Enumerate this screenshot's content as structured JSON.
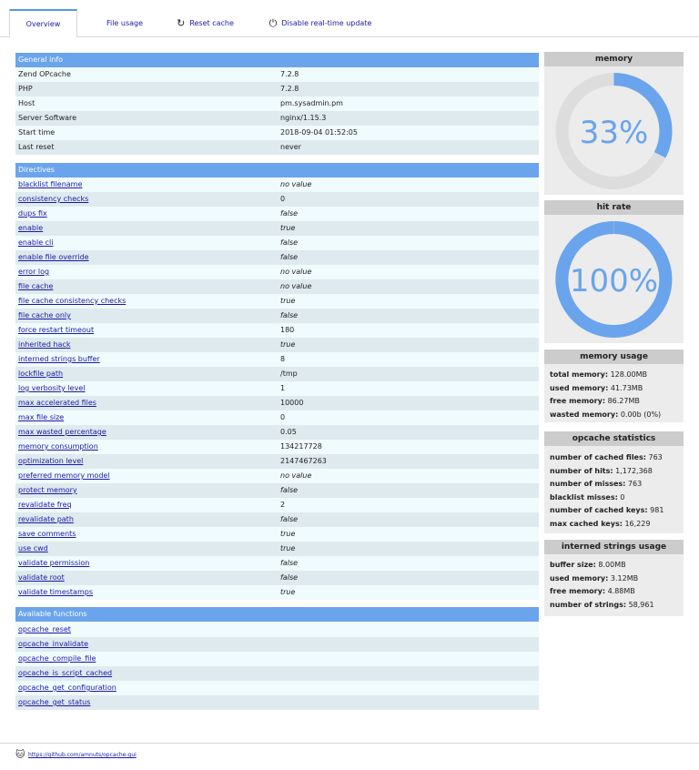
{
  "tabs": {
    "overview": "Overview",
    "file_usage": "File usage",
    "reset_cache": "Reset cache",
    "disable_realtime": "Disable real-time update"
  },
  "general_info": {
    "header": "General info",
    "rows": [
      {
        "k": "Zend OPcache",
        "v": "7.2.8"
      },
      {
        "k": "PHP",
        "v": "7.2.8"
      },
      {
        "k": "Host",
        "v": "pm.sysadmin.pm"
      },
      {
        "k": "Server Software",
        "v": "nginx/1.15.3"
      },
      {
        "k": "Start time",
        "v": "2018-09-04 01:52:05"
      },
      {
        "k": "Last reset",
        "v": "never"
      }
    ]
  },
  "directives": {
    "header": "Directives",
    "rows": [
      {
        "k": "blacklist filename",
        "v": "no value",
        "italic": true
      },
      {
        "k": "consistency checks",
        "v": "0",
        "italic": false
      },
      {
        "k": "dups fix",
        "v": "false",
        "italic": true
      },
      {
        "k": "enable",
        "v": "true",
        "italic": true
      },
      {
        "k": "enable cli",
        "v": "false",
        "italic": true
      },
      {
        "k": "enable file override",
        "v": "false",
        "italic": true
      },
      {
        "k": "error log",
        "v": "no value",
        "italic": true
      },
      {
        "k": "file cache",
        "v": "no value",
        "italic": true
      },
      {
        "k": "file cache consistency checks",
        "v": "true",
        "italic": true
      },
      {
        "k": "file cache only",
        "v": "false",
        "italic": true
      },
      {
        "k": "force restart timeout",
        "v": "180",
        "italic": false
      },
      {
        "k": "inherited hack",
        "v": "true",
        "italic": true
      },
      {
        "k": "interned strings buffer",
        "v": "8",
        "italic": false
      },
      {
        "k": "lockfile path",
        "v": "/tmp",
        "italic": false
      },
      {
        "k": "log verbosity level",
        "v": "1",
        "italic": false
      },
      {
        "k": "max accelerated files",
        "v": "10000",
        "italic": false
      },
      {
        "k": "max file size",
        "v": "0",
        "italic": false
      },
      {
        "k": "max wasted percentage",
        "v": "0.05",
        "italic": false
      },
      {
        "k": "memory consumption",
        "v": "134217728",
        "italic": false
      },
      {
        "k": "optimization level",
        "v": "2147467263",
        "italic": false
      },
      {
        "k": "preferred memory model",
        "v": "no value",
        "italic": true
      },
      {
        "k": "protect memory",
        "v": "false",
        "italic": true
      },
      {
        "k": "revalidate freq",
        "v": "2",
        "italic": false
      },
      {
        "k": "revalidate path",
        "v": "false",
        "italic": true
      },
      {
        "k": "save comments",
        "v": "true",
        "italic": true
      },
      {
        "k": "use cwd",
        "v": "true",
        "italic": true
      },
      {
        "k": "validate permission",
        "v": "false",
        "italic": true
      },
      {
        "k": "validate root",
        "v": "false",
        "italic": true
      },
      {
        "k": "validate timestamps",
        "v": "true",
        "italic": true
      }
    ]
  },
  "functions": {
    "header": "Available functions",
    "rows": [
      "opcache_reset",
      "opcache_invalidate",
      "opcache_compile_file",
      "opcache_is_script_cached",
      "opcache_get_configuration",
      "opcache_get_status"
    ]
  },
  "memory_gauge": {
    "title": "memory",
    "label": "33%",
    "fraction": 0.326
  },
  "hitrate_gauge": {
    "title": "hit rate",
    "label": "100%",
    "fraction": 0.9993
  },
  "memory_usage": {
    "title": "memory usage",
    "rows": [
      {
        "k": "total memory:",
        "v": "128.00MB"
      },
      {
        "k": "used memory:",
        "v": "41.73MB"
      },
      {
        "k": "free memory:",
        "v": "86.27MB"
      },
      {
        "k": "wasted memory:",
        "v": "0.00b (0%)"
      }
    ]
  },
  "opcache_stats": {
    "title": "opcache statistics",
    "rows": [
      {
        "k": "number of cached files:",
        "v": "763"
      },
      {
        "k": "number of hits:",
        "v": "1,172,368"
      },
      {
        "k": "number of misses:",
        "v": "763"
      },
      {
        "k": "blacklist misses:",
        "v": "0"
      },
      {
        "k": "number of cached keys:",
        "v": "981"
      },
      {
        "k": "max cached keys:",
        "v": "16,229"
      }
    ]
  },
  "interned": {
    "title": "interned strings usage",
    "rows": [
      {
        "k": "buffer size:",
        "v": "8.00MB"
      },
      {
        "k": "used memory:",
        "v": "3.12MB"
      },
      {
        "k": "free memory:",
        "v": "4.88MB"
      },
      {
        "k": "number of strings:",
        "v": "58,961"
      }
    ]
  },
  "footer": {
    "link": "https://github.com/amnuts/opcache-gui"
  },
  "colors": {
    "accent": "#6aa4ec",
    "gauge_track": "#dddddd",
    "link": "#1a1aa6"
  }
}
